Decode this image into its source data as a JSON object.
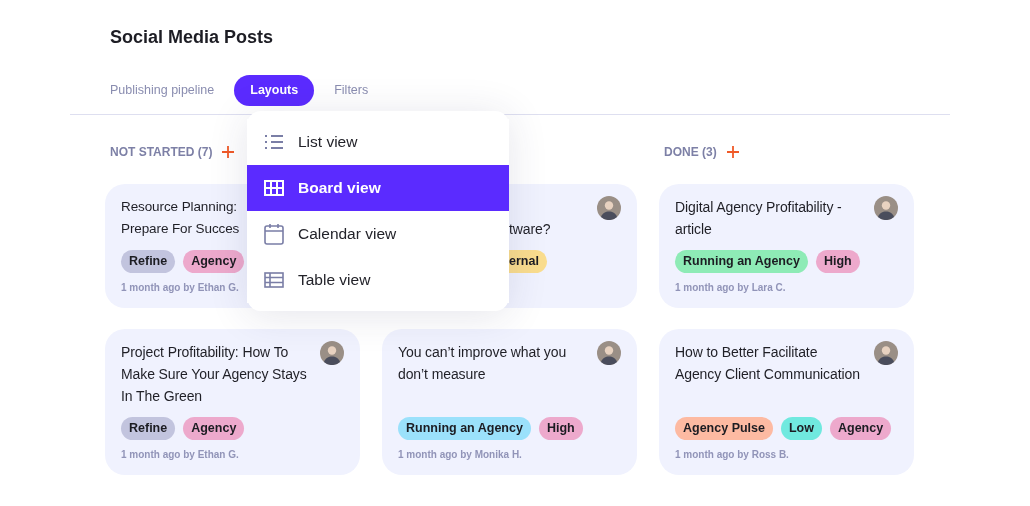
{
  "title": "Social Media Posts",
  "tabs": [
    {
      "label": "Publishing pipeline",
      "selected": false
    },
    {
      "label": "Layouts",
      "selected": true
    },
    {
      "label": "Filters",
      "selected": false
    }
  ],
  "columns": [
    {
      "header": "NOT STARTED (7)",
      "cards": [
        {
          "kind": "cut_right",
          "title": "Resource Planning:\nPrepare For Succes",
          "tags": [
            {
              "label": "Refine",
              "color": "#c2c4de"
            },
            {
              "label": "Agency",
              "color": "#eda9cc"
            }
          ],
          "meta": "1 month ago by Ethan G."
        },
        {
          "kind": "full",
          "title": "Project Profitability: How To Make Sure Your Agency Stays In The Green",
          "tags": [
            {
              "label": "Refine",
              "color": "#c2c4de"
            },
            {
              "label": "Agency",
              "color": "#eda9cc"
            }
          ],
          "meta": "1 month ago by Ethan G."
        }
      ]
    },
    {
      "cards": [
        {
          "kind": "cut_left",
          "title": "\ntware?",
          "tags": [
            {
              "label": "ernal",
              "color": "#fadd8e"
            }
          ]
        },
        {
          "kind": "full",
          "title": "You can’t improve what you don’t measure",
          "tags": [
            {
              "label": "Running an Agency",
              "color": "#9be1fb"
            },
            {
              "label": "High",
              "color": "#eda9cc"
            }
          ],
          "meta": "1 month ago by Monika H."
        }
      ]
    },
    {
      "header": "DONE (3)",
      "cards": [
        {
          "kind": "full",
          "title": "Digital Agency Profitability - article",
          "tags": [
            {
              "label": "Running an Agency",
              "color": "#8eebb6"
            },
            {
              "label": "High",
              "color": "#eda9cc"
            }
          ],
          "meta": "1 month ago by Lara C."
        },
        {
          "kind": "full",
          "title": "How to Better Facilitate Agency Client Communication",
          "tags": [
            {
              "label": "Agency Pulse",
              "color": "#fdbaa2"
            },
            {
              "label": "Low",
              "color": "#70e9df"
            },
            {
              "label": "Agency",
              "color": "#eda9cc"
            }
          ],
          "meta": "1 month ago by Ross B."
        }
      ]
    }
  ],
  "layout_menu": {
    "items": [
      {
        "kind": "list",
        "label": "List view",
        "selected": false
      },
      {
        "kind": "board",
        "label": "Board view",
        "selected": true
      },
      {
        "kind": "calendar",
        "label": "Calendar view",
        "selected": false
      },
      {
        "kind": "table",
        "label": "Table view",
        "selected": false
      }
    ]
  }
}
